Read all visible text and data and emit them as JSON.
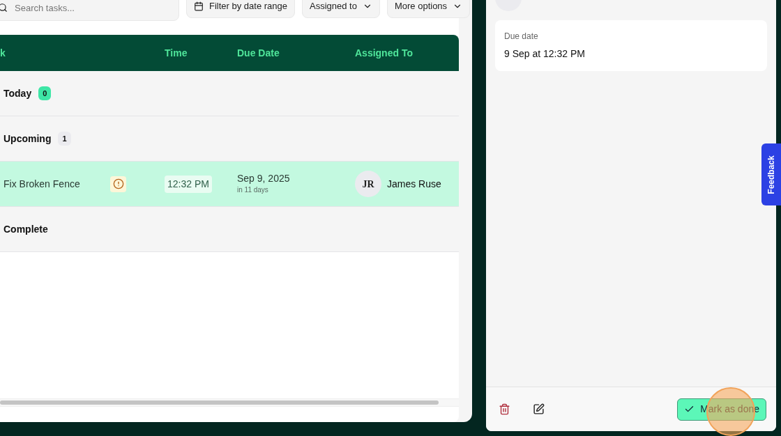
{
  "toolbar": {
    "search": {
      "placeholder": "Search tasks..."
    },
    "buttons": [
      {
        "label": "Filter by date range",
        "kind": "date"
      },
      {
        "label": "Assigned to",
        "kind": "dropdown"
      },
      {
        "label": "More options",
        "kind": "dropdown"
      }
    ]
  },
  "table": {
    "columns": [
      "k",
      "Time",
      "Due Date",
      "Assigned To"
    ],
    "groups": [
      {
        "title": "Today",
        "count": "0",
        "color": "#3ee6a6"
      },
      {
        "title": "Upcoming",
        "count": "1",
        "color": "#ebebef",
        "rows": [
          {
            "task": "Fix Broken Fence",
            "flagged": true,
            "time": "12:32 PM",
            "due_date": "Sep 9, 2025",
            "due_relative": "in 11 days",
            "assignee_initials": "JR",
            "assignee": "James Ruse",
            "selected": true
          }
        ]
      },
      {
        "title": "Complete"
      }
    ]
  },
  "detail": {
    "due": {
      "label": "Due date",
      "value": "9 Sep at 12:32 PM"
    },
    "actions": [
      {
        "kind": "delete"
      },
      {
        "kind": "edit"
      }
    ],
    "primary_button": "Mark as done"
  },
  "feedback_tab": "Feedback"
}
